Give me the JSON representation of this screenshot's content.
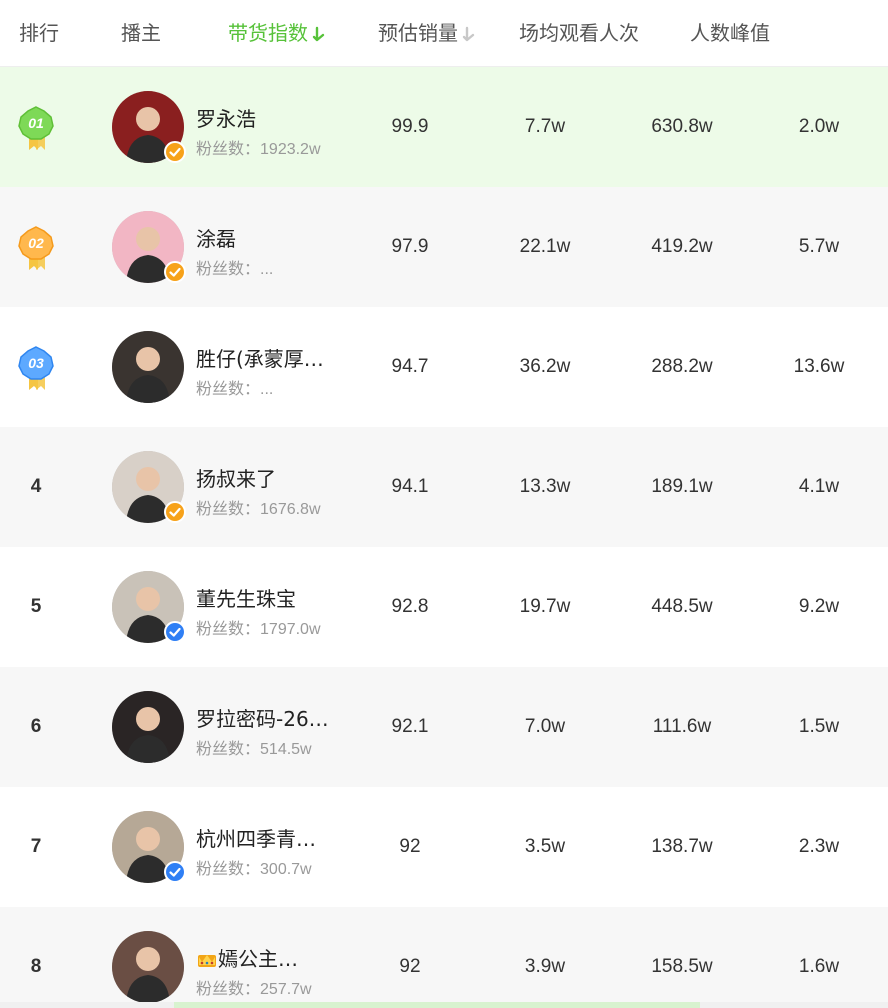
{
  "header": {
    "rank": "排行",
    "streamer": "播主",
    "sales_index": "带货指数",
    "est_sales": "预估销量",
    "avg_viewers": "场均观看人次",
    "peak_viewers": "人数峰值"
  },
  "colors": {
    "accent": "#57c23a",
    "row_highlight": "#edfbe8",
    "badge_orange": "#f7a21a",
    "badge_blue": "#2f7ff5"
  },
  "fans_label": "粉丝数：",
  "rows": [
    {
      "rank": "01",
      "medal": "gold-green",
      "name": "罗永浩",
      "fans": "1923.2w",
      "badge": "orange",
      "index": "99.9",
      "sales": "7.7w",
      "avg": "630.8w",
      "peak": "2.0w"
    },
    {
      "rank": "02",
      "medal": "orange",
      "name": "涂磊",
      "fans": "...",
      "badge": "orange",
      "index": "97.9",
      "sales": "22.1w",
      "avg": "419.2w",
      "peak": "5.7w"
    },
    {
      "rank": "03",
      "medal": "blue",
      "name": "胜仔(承蒙厚…",
      "fans": "...",
      "badge": "none",
      "index": "94.7",
      "sales": "36.2w",
      "avg": "288.2w",
      "peak": "13.6w"
    },
    {
      "rank": "4",
      "medal": "none",
      "name": "扬叔来了",
      "fans": "1676.8w",
      "badge": "orange",
      "index": "94.1",
      "sales": "13.3w",
      "avg": "189.1w",
      "peak": "4.1w"
    },
    {
      "rank": "5",
      "medal": "none",
      "name": "董先生珠宝",
      "fans": "1797.0w",
      "badge": "blue",
      "index": "92.8",
      "sales": "19.7w",
      "avg": "448.5w",
      "peak": "9.2w"
    },
    {
      "rank": "6",
      "medal": "none",
      "name": "罗拉密码-26…",
      "fans": "514.5w",
      "badge": "none",
      "index": "92.1",
      "sales": "7.0w",
      "avg": "111.6w",
      "peak": "1.5w"
    },
    {
      "rank": "7",
      "medal": "none",
      "name": "杭州四季青…",
      "fans": "300.7w",
      "badge": "blue",
      "index": "92",
      "sales": "3.5w",
      "avg": "138.7w",
      "peak": "2.3w"
    },
    {
      "rank": "8",
      "medal": "none",
      "name": "嫣公主…",
      "crown": true,
      "fans": "257.7w",
      "badge": "none",
      "index": "92",
      "sales": "3.9w",
      "avg": "158.5w",
      "peak": "1.6w"
    }
  ],
  "avatars": [
    "#8a1f1f",
    "#f2b6c4",
    "#3a3430",
    "#d8d0c8",
    "#c9c2b8",
    "#2a2525",
    "#b6a896",
    "#6a4e44"
  ]
}
